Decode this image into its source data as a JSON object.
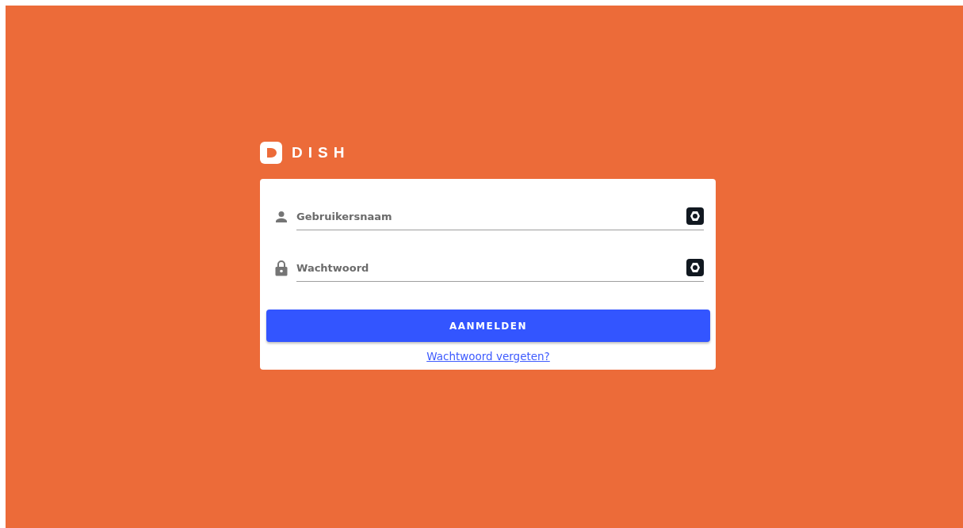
{
  "logo": {
    "text": "DISH"
  },
  "fields": [
    {
      "kind": "user",
      "placeholder": "Gebruikersnaam"
    },
    {
      "kind": "lock",
      "placeholder": "Wachtwoord"
    }
  ],
  "submit_button": {
    "label": "AANMELDEN"
  },
  "forgot_link": {
    "label": "Wachtwoord vergeten?"
  }
}
